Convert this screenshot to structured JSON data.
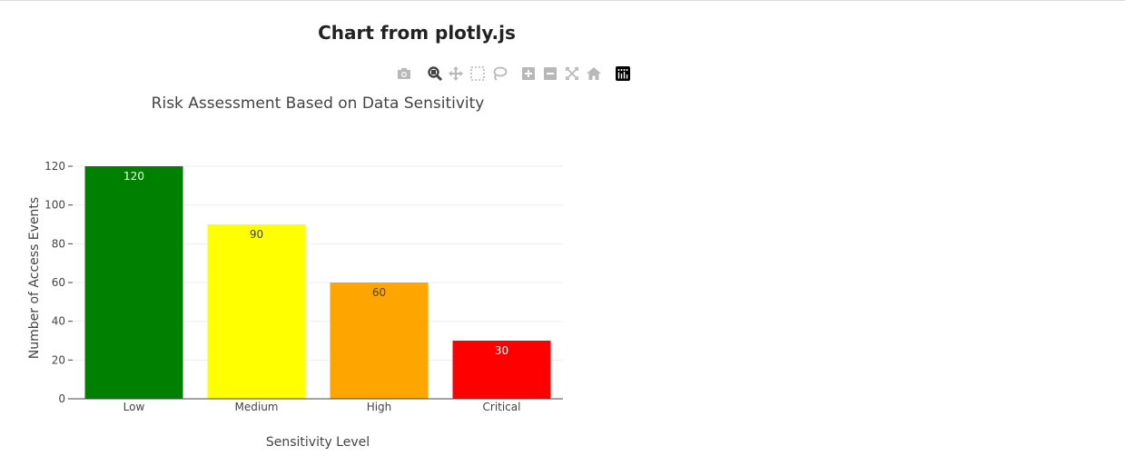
{
  "page": {
    "title": "Chart from plotly.js"
  },
  "modebar": {
    "buttons": [
      {
        "id": "camera",
        "icon": "camera-icon",
        "x": 0
      },
      {
        "id": "zoom",
        "icon": "zoom-icon",
        "x": 34,
        "active": true
      },
      {
        "id": "pan",
        "icon": "pan-icon",
        "x": 57
      },
      {
        "id": "box-select",
        "icon": "box-select-icon",
        "x": 81
      },
      {
        "id": "lasso",
        "icon": "lasso-icon",
        "x": 105
      },
      {
        "id": "zoom-in",
        "icon": "zoom-in-icon",
        "x": 137
      },
      {
        "id": "zoom-out",
        "icon": "zoom-out-icon",
        "x": 161
      },
      {
        "id": "autoscale",
        "icon": "autoscale-icon",
        "x": 185
      },
      {
        "id": "reset",
        "icon": "home-icon",
        "x": 209
      },
      {
        "id": "plotly",
        "icon": "plotly-logo-icon",
        "x": 241
      }
    ]
  },
  "chart_data": {
    "type": "bar",
    "title": "Risk Assessment Based on Data Sensitivity",
    "xlabel": "Sensitivity Level",
    "ylabel": "Number of Access Events",
    "categories": [
      "Low",
      "Medium",
      "High",
      "Critical"
    ],
    "values": [
      120,
      90,
      60,
      30
    ],
    "colors": [
      "#008000",
      "#ffff00",
      "#ffa500",
      "#ff0000"
    ],
    "label_colors": [
      "#ffffff",
      "#444444",
      "#444444",
      "#ffffff"
    ],
    "data_labels": [
      "120",
      "90",
      "60",
      "30"
    ],
    "ylim": [
      0,
      120
    ],
    "yticks": [
      0,
      20,
      40,
      60,
      80,
      100,
      120
    ],
    "grid": true,
    "legend": "none"
  }
}
